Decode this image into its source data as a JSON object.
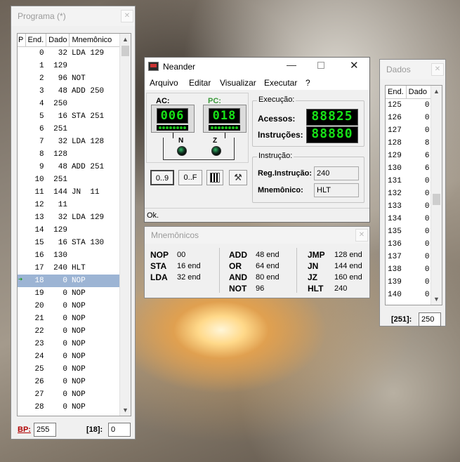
{
  "programa": {
    "title": "Programa  (*)",
    "columns": [
      "P",
      "End.",
      "Dado",
      "Mnemônico"
    ],
    "rows": [
      {
        "p": "",
        "end": "0",
        "dado": "32",
        "mn": "LDA 129"
      },
      {
        "p": "",
        "end": "1",
        "dado": "129",
        "mn": ""
      },
      {
        "p": "",
        "end": "2",
        "dado": "96",
        "mn": "NOT"
      },
      {
        "p": "",
        "end": "3",
        "dado": "48",
        "mn": "ADD 250"
      },
      {
        "p": "",
        "end": "4",
        "dado": "250",
        "mn": ""
      },
      {
        "p": "",
        "end": "5",
        "dado": "16",
        "mn": "STA 251"
      },
      {
        "p": "",
        "end": "6",
        "dado": "251",
        "mn": ""
      },
      {
        "p": "",
        "end": "7",
        "dado": "32",
        "mn": "LDA 128"
      },
      {
        "p": "",
        "end": "8",
        "dado": "128",
        "mn": ""
      },
      {
        "p": "",
        "end": "9",
        "dado": "48",
        "mn": "ADD 251"
      },
      {
        "p": "",
        "end": "10",
        "dado": "251",
        "mn": ""
      },
      {
        "p": "",
        "end": "11",
        "dado": "144",
        "mn": "JN  11"
      },
      {
        "p": "",
        "end": "12",
        "dado": "11",
        "mn": ""
      },
      {
        "p": "",
        "end": "13",
        "dado": "32",
        "mn": "LDA 129"
      },
      {
        "p": "",
        "end": "14",
        "dado": "129",
        "mn": ""
      },
      {
        "p": "",
        "end": "15",
        "dado": "16",
        "mn": "STA 130"
      },
      {
        "p": "",
        "end": "16",
        "dado": "130",
        "mn": ""
      },
      {
        "p": "",
        "end": "17",
        "dado": "240",
        "mn": "HLT"
      },
      {
        "p": "➜",
        "end": "18",
        "dado": "0",
        "mn": "NOP"
      },
      {
        "p": "",
        "end": "19",
        "dado": "0",
        "mn": "NOP"
      },
      {
        "p": "",
        "end": "20",
        "dado": "0",
        "mn": "NOP"
      },
      {
        "p": "",
        "end": "21",
        "dado": "0",
        "mn": "NOP"
      },
      {
        "p": "",
        "end": "22",
        "dado": "0",
        "mn": "NOP"
      },
      {
        "p": "",
        "end": "23",
        "dado": "0",
        "mn": "NOP"
      },
      {
        "p": "",
        "end": "24",
        "dado": "0",
        "mn": "NOP"
      },
      {
        "p": "",
        "end": "25",
        "dado": "0",
        "mn": "NOP"
      },
      {
        "p": "",
        "end": "26",
        "dado": "0",
        "mn": "NOP"
      },
      {
        "p": "",
        "end": "27",
        "dado": "0",
        "mn": "NOP"
      },
      {
        "p": "",
        "end": "28",
        "dado": "0",
        "mn": "NOP"
      }
    ],
    "selected_index": 18,
    "bp_label": "BP:",
    "bp_value": "255",
    "addr_label": "[18]:",
    "addr_value": "0"
  },
  "neander": {
    "title": "Neander",
    "menu": [
      "Arquivo",
      "Editar",
      "Visualizar",
      "Executar",
      "?"
    ],
    "ac_label": "AC:",
    "ac_value": "006",
    "pc_label": "PC:",
    "pc_value": "018",
    "n_label": "N",
    "z_label": "Z",
    "execucao_label": "Execução:",
    "acessos_label": "Acessos:",
    "acessos_value": "88825",
    "instrucoes_label": "Instruções:",
    "instrucoes_value": "88880",
    "instrucao_label": "Instrução:",
    "reg_label": "Reg.Instrução:",
    "reg_value": "240",
    "mnemonico_label": "Mnemônico:",
    "mnemonico_value": "HLT",
    "btn_dec": "0..9",
    "btn_hex": "0..F",
    "status": "Ok."
  },
  "mnemonicos": {
    "title": "Mnemônicos",
    "entries": [
      {
        "op": "NOP",
        "code": "00"
      },
      {
        "op": "STA",
        "code": "16 end"
      },
      {
        "op": "LDA",
        "code": "32 end"
      },
      {
        "op": "ADD",
        "code": "48 end"
      },
      {
        "op": "OR",
        "code": "64 end"
      },
      {
        "op": "AND",
        "code": "80 end"
      },
      {
        "op": "NOT",
        "code": "96"
      },
      {
        "op": "JMP",
        "code": "128 end"
      },
      {
        "op": "JN",
        "code": "144 end"
      },
      {
        "op": "JZ",
        "code": "160 end"
      },
      {
        "op": "HLT",
        "code": "240"
      }
    ]
  },
  "dados": {
    "title": "Dados",
    "columns": [
      "End.",
      "Dado"
    ],
    "rows": [
      {
        "end": "125",
        "dado": "0"
      },
      {
        "end": "126",
        "dado": "0"
      },
      {
        "end": "127",
        "dado": "0"
      },
      {
        "end": "128",
        "dado": "8"
      },
      {
        "end": "129",
        "dado": "6"
      },
      {
        "end": "130",
        "dado": "6"
      },
      {
        "end": "131",
        "dado": "0"
      },
      {
        "end": "132",
        "dado": "0"
      },
      {
        "end": "133",
        "dado": "0"
      },
      {
        "end": "134",
        "dado": "0"
      },
      {
        "end": "135",
        "dado": "0"
      },
      {
        "end": "136",
        "dado": "0"
      },
      {
        "end": "137",
        "dado": "0"
      },
      {
        "end": "138",
        "dado": "0"
      },
      {
        "end": "139",
        "dado": "0"
      },
      {
        "end": "140",
        "dado": "0"
      }
    ],
    "addr_label": "[251]:",
    "addr_value": "250"
  }
}
